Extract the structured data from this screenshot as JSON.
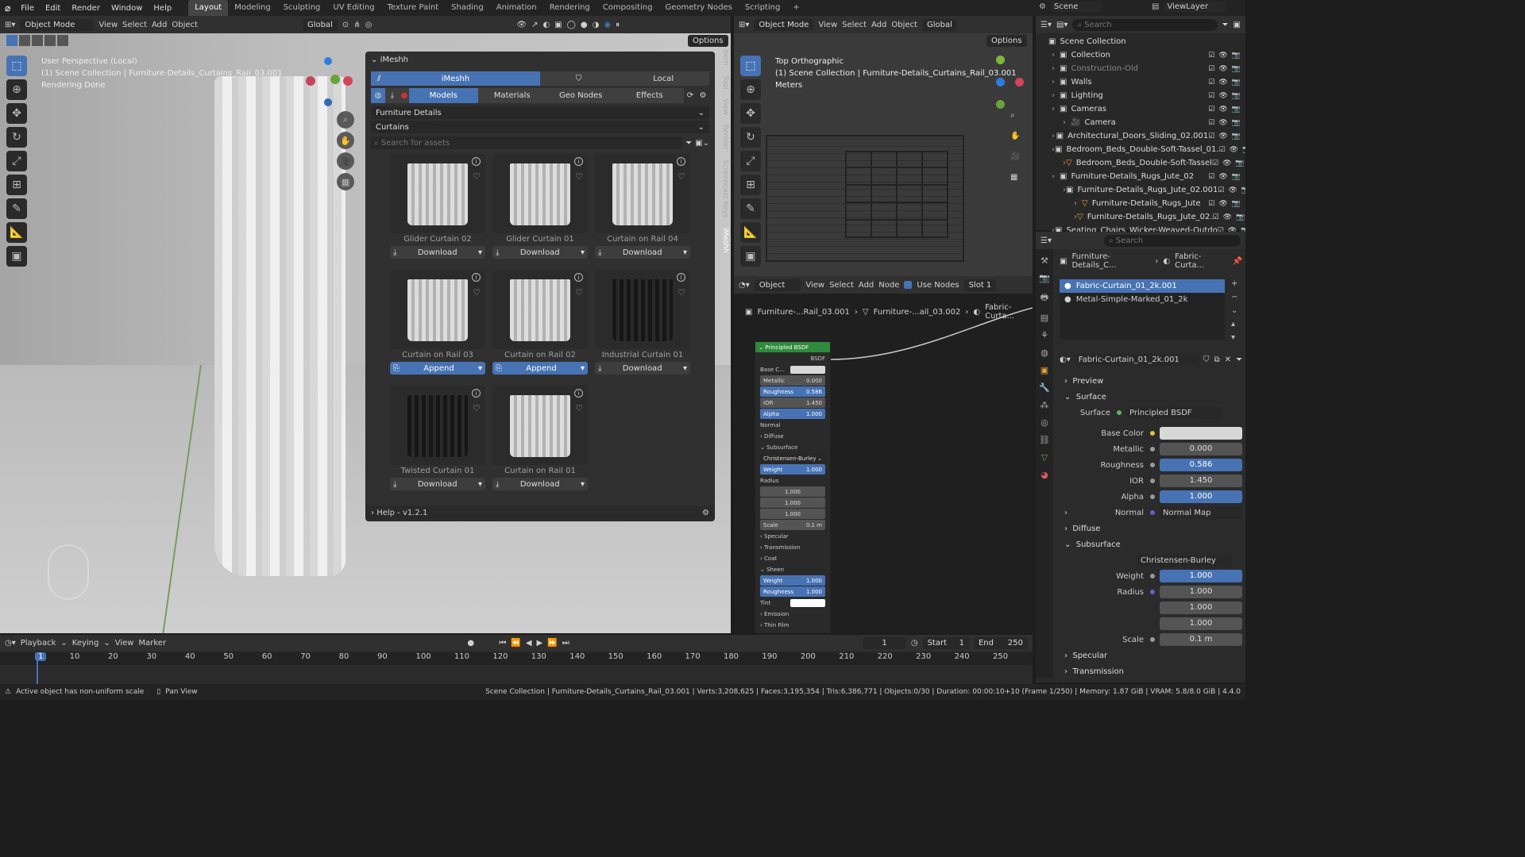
{
  "topbar": {
    "menus": [
      "File",
      "Edit",
      "Render",
      "Window",
      "Help"
    ],
    "workspaces": [
      "Layout",
      "Modeling",
      "Sculpting",
      "UV Editing",
      "Texture Paint",
      "Shading",
      "Animation",
      "Rendering",
      "Compositing",
      "Geometry Nodes",
      "Scripting"
    ],
    "active_workspace": "Layout",
    "scene": "Scene",
    "viewlayer": "ViewLayer"
  },
  "viewport_left": {
    "mode": "Object Mode",
    "menus": [
      "View",
      "Select",
      "Add",
      "Object"
    ],
    "orientation": "Global",
    "options": "Options",
    "overlay_line1": "User Perspective (Local)",
    "overlay_line2": "(1) Scene Collection | Furniture-Details_Curtains_Rail_03.001",
    "overlay_line3": "Rendering Done"
  },
  "imeshh": {
    "title": "iMeshh",
    "tab_imeshh": "iMeshh",
    "tab_local": "Local",
    "cat_tabs": [
      "Models",
      "Materials",
      "Geo Nodes",
      "Effects"
    ],
    "category": "Furniture Details",
    "subcategory": "Curtains",
    "search_placeholder": "Search for assets",
    "assets": [
      {
        "name": "Glider Curtain 02",
        "action": "Download",
        "dark": false,
        "append": false
      },
      {
        "name": "Glider Curtain 01",
        "action": "Download",
        "dark": false,
        "append": false
      },
      {
        "name": "Curtain on Rail 04",
        "action": "Download",
        "dark": false,
        "append": false
      },
      {
        "name": "Curtain on Rail 03",
        "action": "Append",
        "dark": false,
        "append": true
      },
      {
        "name": "Curtain on Rail 02",
        "action": "Append",
        "dark": false,
        "append": true
      },
      {
        "name": "Industrial Curtain 01",
        "action": "Download",
        "dark": true,
        "append": false
      },
      {
        "name": "Twisted Curtain 01",
        "action": "Download",
        "dark": true,
        "append": false
      },
      {
        "name": "Curtain on Rail 01",
        "action": "Download",
        "dark": false,
        "append": false
      }
    ],
    "help": "Help - v1.2.1"
  },
  "side_tabs": [
    "Item",
    "Tool",
    "View",
    "Render",
    "Screencast Keys",
    "iMeshh"
  ],
  "viewport_right": {
    "mode": "Object Mode",
    "menus": [
      "View",
      "Select",
      "Add",
      "Object"
    ],
    "orientation": "Global",
    "options": "Options",
    "overlay_line1": "Top Orthographic",
    "overlay_line2": "(1) Scene Collection | Furniture-Details_Curtains_Rail_03.001",
    "overlay_line3": "Meters"
  },
  "node_editor": {
    "type": "Object",
    "menus": [
      "View",
      "Select",
      "Add",
      "Node"
    ],
    "use_nodes": "Use Nodes",
    "slot": "Slot 1",
    "breadcrumb": [
      "Furniture-...Rail_03.001",
      "Furniture-...ail_03.002",
      "Fabric-Curta..."
    ],
    "node_title": "Principled BSDF",
    "bsdf": "BSDF",
    "fields": [
      {
        "label": "Base C...",
        "value": "",
        "type": "color"
      },
      {
        "label": "Metallic",
        "value": "0.000",
        "type": "gray"
      },
      {
        "label": "Roughness",
        "value": "0.586",
        "type": "blue"
      },
      {
        "label": "IOR",
        "value": "1.450",
        "type": "gray"
      },
      {
        "label": "Alpha",
        "value": "1.000",
        "type": "blue"
      }
    ],
    "normal": "Normal",
    "diffuse": "Diffuse",
    "subsurface": "Subsurface",
    "sss_method": "Christensen-Burley",
    "weight_label": "Weight",
    "weight": "1.000",
    "radius_label": "Radius",
    "radius": [
      "1.000",
      "1.000",
      "1.000"
    ],
    "scale_label": "Scale",
    "scale": "0.1 m",
    "specular": "Specular",
    "transmission": "Transmission",
    "coat": "Coat",
    "sheen": "Sheen",
    "sheen_weight": "1.000",
    "sheen_roughness_label": "Roughness",
    "sheen_roughness": "1.000",
    "tint": "Tint",
    "emission": "Emission",
    "thin_film": "Thin Film"
  },
  "outliner": {
    "search_placeholder": "Search",
    "rows": [
      {
        "indent": 0,
        "label": "Scene Collection",
        "type": "scene"
      },
      {
        "indent": 1,
        "label": "Collection",
        "type": "coll"
      },
      {
        "indent": 1,
        "label": "Construction-Old",
        "type": "coll-dim"
      },
      {
        "indent": 1,
        "label": "Walls",
        "type": "coll"
      },
      {
        "indent": 1,
        "label": "Lighting",
        "type": "coll"
      },
      {
        "indent": 1,
        "label": "Cameras",
        "type": "coll"
      },
      {
        "indent": 2,
        "label": "Camera",
        "type": "cam"
      },
      {
        "indent": 1,
        "label": "Architectural_Doors_Sliding_02.001",
        "type": "coll"
      },
      {
        "indent": 1,
        "label": "Bedroom_Beds_Double-Soft-Tassel_01.",
        "type": "coll"
      },
      {
        "indent": 2,
        "label": "Bedroom_Beds_Double-Soft-Tassel",
        "type": "mesh"
      },
      {
        "indent": 1,
        "label": "Furniture-Details_Rugs_Jute_02",
        "type": "coll"
      },
      {
        "indent": 2,
        "label": "Furniture-Details_Rugs_Jute_02.001",
        "type": "coll"
      },
      {
        "indent": 3,
        "label": "Furniture-Details_Rugs_Jute",
        "type": "mesh"
      },
      {
        "indent": 3,
        "label": "Furniture-Details_Rugs_Jute_02.",
        "type": "mesh"
      },
      {
        "indent": 1,
        "label": "Seating_Chairs_Wicker-Weaved-Outdo",
        "type": "coll"
      }
    ]
  },
  "properties": {
    "search_placeholder": "Search",
    "breadcrumb_obj": "Furniture-Details_C...",
    "breadcrumb_mat": "Fabric-Curta...",
    "slots": [
      "Fabric-Curtain_01_2k.001",
      "Metal-Simple-Marked_01_2k"
    ],
    "material_name": "Fabric-Curtain_01_2k.001",
    "sections": {
      "preview": "Preview",
      "surface": "Surface",
      "diffuse": "Diffuse",
      "subsurface": "Subsurface",
      "specular": "Specular",
      "transmission": "Transmission"
    },
    "surface_label": "Surface",
    "surface_value": "Principled BSDF",
    "rows": [
      {
        "label": "Base Color",
        "value": "",
        "type": "color"
      },
      {
        "label": "Metallic",
        "value": "0.000",
        "type": "gray"
      },
      {
        "label": "Roughness",
        "value": "0.586",
        "type": "blue"
      },
      {
        "label": "IOR",
        "value": "1.450",
        "type": "gray"
      },
      {
        "label": "Alpha",
        "value": "1.000",
        "type": "blue"
      }
    ],
    "normal_label": "Normal",
    "normal_value": "Normal Map",
    "sss_method": "Christensen-Burley",
    "weight_label": "Weight",
    "weight": "1.000",
    "radius_label": "Radius",
    "radius": [
      "1.000",
      "1.000",
      "1.000"
    ],
    "scale_label": "Scale",
    "scale": "0.1 m"
  },
  "timeline": {
    "menus": [
      "Playback",
      "Keying",
      "View",
      "Marker"
    ],
    "current_frame": "1",
    "start_label": "Start",
    "start": "1",
    "end_label": "End",
    "end": "250",
    "ticks": [
      "1",
      "10",
      "20",
      "30",
      "40",
      "50",
      "60",
      "70",
      "80",
      "90",
      "100",
      "110",
      "120",
      "130",
      "140",
      "150",
      "160",
      "170",
      "180",
      "190",
      "200",
      "210",
      "220",
      "230",
      "240",
      "250"
    ]
  },
  "statusbar": {
    "warning": "Active object has non-uniform scale",
    "pan": "Pan View",
    "stats": "Scene Collection | Furniture-Details_Curtains_Rail_03.001 | Verts:3,208,625 | Faces:3,195,354 | Tris:6,386,771 | Objects:0/30 | Duration: 00:00:10+10 (Frame 1/250) | Memory: 1.87 GiB | VRAM: 5.8/8.0 GiB | 4.4.0"
  },
  "colors": {
    "accent": "#4772b3",
    "panel": "#303030",
    "bg": "#1d1d1d",
    "viewport": "#3c3c3c"
  }
}
